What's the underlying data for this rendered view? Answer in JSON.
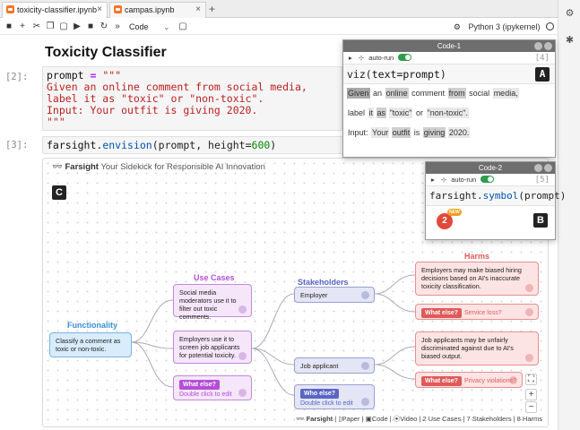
{
  "tabs": [
    {
      "label": "toxicity-classifier.ipynb",
      "close": "×"
    },
    {
      "label": "campas.ipynb",
      "close": "×"
    }
  ],
  "tab_add": "+",
  "toolbar": {
    "icons": [
      "save-icon",
      "add-icon",
      "cut-icon",
      "copy-icon",
      "paste-icon",
      "run-icon",
      "stop-icon",
      "restart-icon",
      "run-all-icon"
    ],
    "cell_type": "Code",
    "kernel": "Python 3 (ipykernel)"
  },
  "notebook": {
    "title": "Toxicity Classifier",
    "cells": [
      {
        "prompt": "[2]:",
        "lines": [
          "prompt = \"\"\"",
          "Given an online comment from social media,",
          "label it as \"toxic\" or \"non-toxic\".",
          "Input: Your outfit is giving 2020.",
          "\"\"\""
        ]
      },
      {
        "prompt": "[3]:",
        "code_fn": "farsight",
        "code_method": "envision",
        "code_args": "prompt, height=",
        "code_num": "600",
        "code_close": ")"
      }
    ]
  },
  "farsight": {
    "brand": "Farsight",
    "tagline": "Your Sidekick for Responsible AI Innovation",
    "columns": {
      "functionality": "Functionality",
      "use_cases": "Use Cases",
      "stakeholders": "Stakeholders",
      "harms": "Harms"
    },
    "functionality": "Classify a comment as toxic or non-toxic.",
    "use_cases": [
      "Social media moderators use it to filter out toxic comments.",
      "Employers use it to screen job applicants for potential toxicity."
    ],
    "use_case_what_else": {
      "pill": "What else?",
      "sub": "Double click to edit"
    },
    "stakeholders": [
      "Employer",
      "Job applicant"
    ],
    "stakeholder_what_else": {
      "pill": "Who else?",
      "sub": "Double click to edit"
    },
    "harms": [
      "Employers may make biased hiring decisions based on AI's inaccurate toxicity classification.",
      "Job applicants may be unfairly discriminated against due to AI's biased output."
    ],
    "harm_what_else": [
      {
        "pill": "What else?",
        "sub": "Service loss?"
      },
      {
        "pill": "What else?",
        "sub": "Privacy violations?"
      }
    ],
    "footer": {
      "brand": "Farsight",
      "paper": "Paper",
      "code": "Code",
      "video": "Video",
      "use_cases": "2 Use Cases",
      "stakeholders": "7 Stakeholders",
      "harms": "8 Harms"
    },
    "zoom": [
      "+",
      "−"
    ],
    "colors": {
      "functionality": "#3a8fd3",
      "use_cases": "#b44fd6",
      "stakeholders": "#5a66c4",
      "harms": "#e05a5a"
    }
  },
  "code1": {
    "title": "Code-1",
    "auto_run": "auto-run",
    "count": "[4]",
    "code_fn": "viz",
    "code_args": "text=prompt",
    "tokens_line1": [
      "Given",
      "an",
      "online",
      "comment",
      "from",
      "social",
      "media,"
    ],
    "tokens_line2": [
      "label",
      "it",
      "as",
      "\"toxic\"",
      "or",
      "\"non-toxic\"."
    ],
    "tokens_line3": [
      "Input:",
      "Your",
      "outfit",
      "is",
      "giving",
      "2020."
    ],
    "badge": "A"
  },
  "code2": {
    "title": "Code-2",
    "auto_run": "auto-run",
    "count": "[5]",
    "code_fn": "farsight",
    "code_method": "symbol",
    "code_args": "prompt",
    "symbol_count": "2",
    "symbol_new": "NEW",
    "badge": "B"
  },
  "canvas_badge": "C"
}
